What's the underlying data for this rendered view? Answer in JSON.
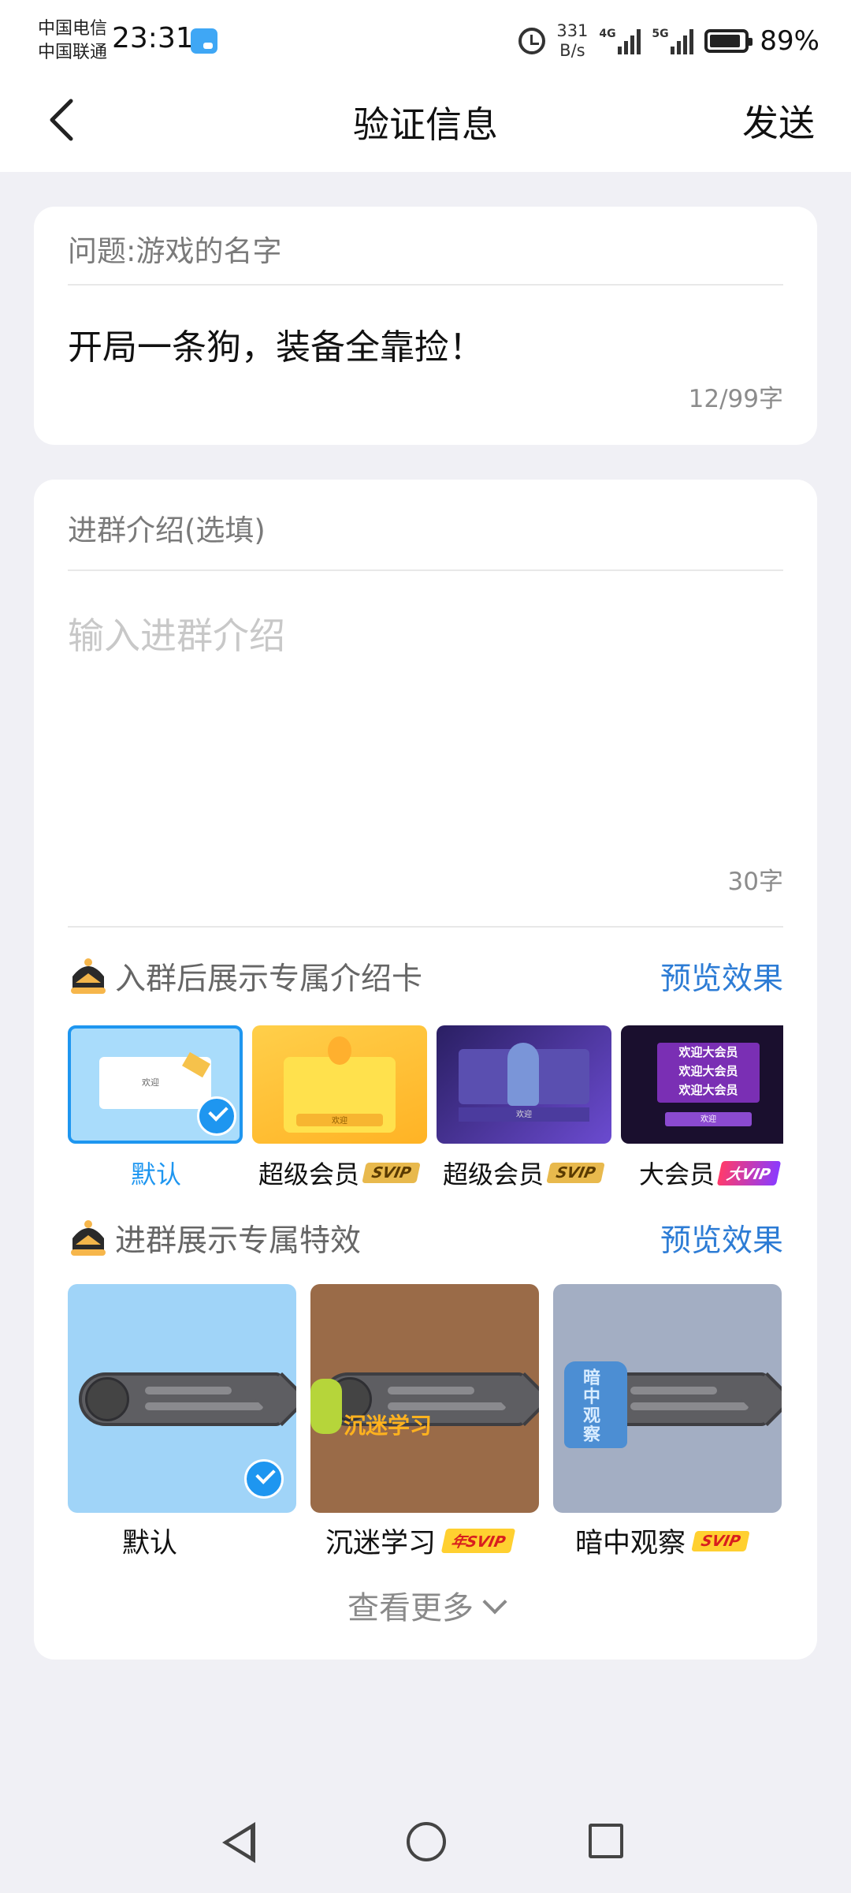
{
  "status_bar": {
    "carrier_1": "中国电信",
    "carrier_2": "中国联通",
    "time": "23:31",
    "net_speed_value": "331",
    "net_speed_unit": "B/s",
    "sim1_tag": "4G",
    "sim2_tag": "5G",
    "battery_percent": "89%",
    "battery_level": 0.89
  },
  "header": {
    "title": "验证信息",
    "send_label": "发送"
  },
  "question_card": {
    "question_label": "问题:游戏的名字",
    "answer_value": "开局一条狗，装备全靠捡！",
    "char_count": "12/99字"
  },
  "intro_card": {
    "label": "进群介绍(选填)",
    "placeholder": "输入进群介绍",
    "char_limit": "30字"
  },
  "intro_card_section": {
    "title": "入群后展示专属介绍卡",
    "preview_label": "预览效果",
    "options": [
      {
        "label": "默认",
        "badge": "",
        "selected": true
      },
      {
        "label": "超级会员",
        "badge": "SVIP",
        "selected": false
      },
      {
        "label": "超级会员",
        "badge": "SVIP",
        "selected": false
      },
      {
        "label": "大会员",
        "badge": "大VIP",
        "selected": false
      }
    ],
    "thumb_text": "欢迎",
    "big_member_text": "欢迎大会员"
  },
  "effects_section": {
    "title": "进群展示专属特效",
    "preview_label": "预览效果",
    "options": [
      {
        "label": "默认",
        "badge": "",
        "selected": true
      },
      {
        "label": "沉迷学习",
        "badge": "年SVIP",
        "overlay": "沉迷学习",
        "selected": false
      },
      {
        "label": "暗中观察",
        "badge": "SVIP",
        "overlay": "暗中观察",
        "selected": false
      }
    ],
    "see_more": "查看更多"
  },
  "colors": {
    "accent_blue": "#2d7cd5",
    "check_blue": "#1e96f0",
    "page_bg": "#f0f0f5"
  }
}
